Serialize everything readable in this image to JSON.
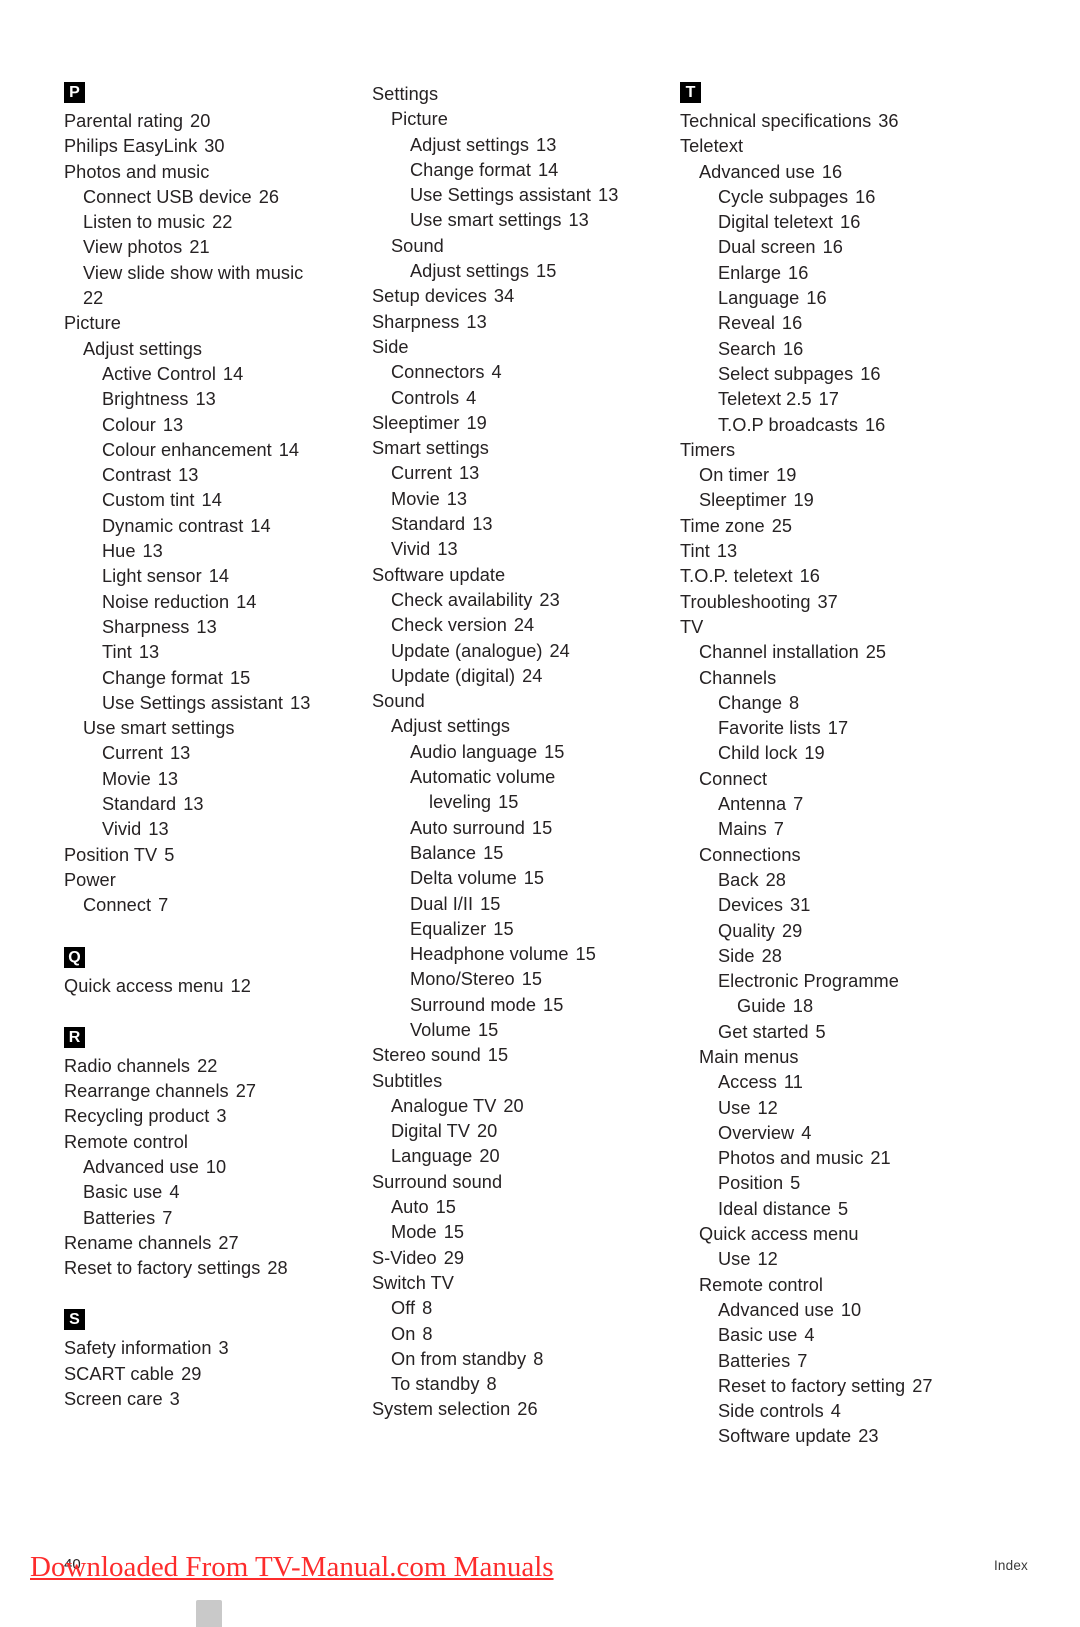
{
  "document": {
    "page_number": "40",
    "footer_label": "Index",
    "watermark_text": "Downloaded From TV-Manual.com Manuals"
  },
  "columns": [
    {
      "groups": [
        {
          "letter": "P",
          "entries": [
            {
              "text": "Parental rating",
              "page": "20",
              "level": 0
            },
            {
              "text": "Philips EasyLink",
              "page": "30",
              "level": 0
            },
            {
              "text": "Photos and music",
              "page": "",
              "level": 0
            },
            {
              "text": "Connect USB device",
              "page": "26",
              "level": 1
            },
            {
              "text": "Listen to music",
              "page": "22",
              "level": 1
            },
            {
              "text": "View photos",
              "page": "21",
              "level": 1
            },
            {
              "text": "View slide show with music",
              "page": "",
              "level": 1
            },
            {
              "text": "22",
              "page": "",
              "level": 1
            },
            {
              "text": "Picture",
              "page": "",
              "level": 0
            },
            {
              "text": "Adjust settings",
              "page": "",
              "level": 1
            },
            {
              "text": "Active Control",
              "page": "14",
              "level": 2
            },
            {
              "text": "Brightness",
              "page": "13",
              "level": 2
            },
            {
              "text": "Colour",
              "page": "13",
              "level": 2
            },
            {
              "text": "Colour enhancement",
              "page": "14",
              "level": 2
            },
            {
              "text": "Contrast",
              "page": "13",
              "level": 2
            },
            {
              "text": "Custom tint",
              "page": "14",
              "level": 2
            },
            {
              "text": "Dynamic contrast",
              "page": "14",
              "level": 2
            },
            {
              "text": "Hue",
              "page": "13",
              "level": 2
            },
            {
              "text": "Light sensor",
              "page": "14",
              "level": 2
            },
            {
              "text": "Noise reduction",
              "page": "14",
              "level": 2
            },
            {
              "text": "Sharpness",
              "page": "13",
              "level": 2
            },
            {
              "text": "Tint",
              "page": "13",
              "level": 2
            },
            {
              "text": "Change format",
              "page": "15",
              "level": 2
            },
            {
              "text": "Use Settings assistant",
              "page": "13",
              "level": 2
            },
            {
              "text": "Use smart settings",
              "page": "",
              "level": 1
            },
            {
              "text": "Current",
              "page": "13",
              "level": 2
            },
            {
              "text": "Movie",
              "page": "13",
              "level": 2
            },
            {
              "text": "Standard",
              "page": "13",
              "level": 2
            },
            {
              "text": "Vivid",
              "page": "13",
              "level": 2
            },
            {
              "text": "Position TV",
              "page": "5",
              "level": 0
            },
            {
              "text": "Power",
              "page": "",
              "level": 0
            },
            {
              "text": "Connect",
              "page": "7",
              "level": 1
            }
          ]
        },
        {
          "letter": "Q",
          "entries": [
            {
              "text": "Quick access menu",
              "page": "12",
              "level": 0
            }
          ]
        },
        {
          "letter": "R",
          "entries": [
            {
              "text": "Radio channels",
              "page": "22",
              "level": 0
            },
            {
              "text": "Rearrange channels",
              "page": "27",
              "level": 0
            },
            {
              "text": "Recycling product",
              "page": "3",
              "level": 0
            },
            {
              "text": "Remote control",
              "page": "",
              "level": 0
            },
            {
              "text": "Advanced use",
              "page": "10",
              "level": 1
            },
            {
              "text": "Basic use",
              "page": "4",
              "level": 1
            },
            {
              "text": "Batteries",
              "page": "7",
              "level": 1
            },
            {
              "text": "Rename channels",
              "page": "27",
              "level": 0
            },
            {
              "text": "Reset to factory settings",
              "page": "28",
              "level": 0
            }
          ]
        },
        {
          "letter": "S",
          "entries": [
            {
              "text": "Safety information",
              "page": "3",
              "level": 0
            },
            {
              "text": "SCART cable",
              "page": "29",
              "level": 0
            },
            {
              "text": "Screen care",
              "page": "3",
              "level": 0
            }
          ]
        }
      ]
    },
    {
      "groups": [
        {
          "letter": "",
          "entries": [
            {
              "text": "Settings",
              "page": "",
              "level": 0
            },
            {
              "text": "Picture",
              "page": "",
              "level": 1
            },
            {
              "text": "Adjust settings",
              "page": "13",
              "level": 2
            },
            {
              "text": "Change format",
              "page": "14",
              "level": 2
            },
            {
              "text": "Use Settings assistant",
              "page": "13",
              "level": 2
            },
            {
              "text": "Use smart settings",
              "page": "13",
              "level": 2
            },
            {
              "text": "Sound",
              "page": "",
              "level": 1
            },
            {
              "text": "Adjust settings",
              "page": "15",
              "level": 2
            },
            {
              "text": "Setup devices",
              "page": "34",
              "level": 0
            },
            {
              "text": "Sharpness",
              "page": "13",
              "level": 0
            },
            {
              "text": "Side",
              "page": "",
              "level": 0
            },
            {
              "text": "Connectors",
              "page": "4",
              "level": 1
            },
            {
              "text": "Controls",
              "page": "4",
              "level": 1
            },
            {
              "text": "Sleeptimer",
              "page": "19",
              "level": 0
            },
            {
              "text": "Smart settings",
              "page": "",
              "level": 0
            },
            {
              "text": "Current",
              "page": "13",
              "level": 1
            },
            {
              "text": "Movie",
              "page": "13",
              "level": 1
            },
            {
              "text": "Standard",
              "page": "13",
              "level": 1
            },
            {
              "text": "Vivid",
              "page": "13",
              "level": 1
            },
            {
              "text": "Software update",
              "page": "",
              "level": 0
            },
            {
              "text": "Check availability",
              "page": "23",
              "level": 1
            },
            {
              "text": "Check version",
              "page": "24",
              "level": 1
            },
            {
              "text": "Update (analogue)",
              "page": "24",
              "level": 1
            },
            {
              "text": "Update (digital)",
              "page": "24",
              "level": 1
            },
            {
              "text": "Sound",
              "page": "",
              "level": 0
            },
            {
              "text": "Adjust settings",
              "page": "",
              "level": 1
            },
            {
              "text": "Audio language",
              "page": "15",
              "level": 2
            },
            {
              "text": "Automatic volume",
              "page": "",
              "level": 2
            },
            {
              "text": "leveling",
              "page": "15",
              "level": 3
            },
            {
              "text": "Auto surround",
              "page": "15",
              "level": 2
            },
            {
              "text": "Balance",
              "page": "15",
              "level": 2
            },
            {
              "text": "Delta volume",
              "page": "15",
              "level": 2
            },
            {
              "text": "Dual I/II",
              "page": "15",
              "level": 2
            },
            {
              "text": "Equalizer",
              "page": "15",
              "level": 2
            },
            {
              "text": "Headphone volume",
              "page": "15",
              "level": 2
            },
            {
              "text": "Mono/Stereo",
              "page": "15",
              "level": 2
            },
            {
              "text": "Surround mode",
              "page": "15",
              "level": 2
            },
            {
              "text": "Volume",
              "page": "15",
              "level": 2
            },
            {
              "text": "Stereo sound",
              "page": "15",
              "level": 0
            },
            {
              "text": "Subtitles",
              "page": "",
              "level": 0
            },
            {
              "text": "Analogue TV",
              "page": "20",
              "level": 1
            },
            {
              "text": "Digital TV",
              "page": "20",
              "level": 1
            },
            {
              "text": "Language",
              "page": "20",
              "level": 1
            },
            {
              "text": "Surround sound",
              "page": "",
              "level": 0
            },
            {
              "text": "Auto",
              "page": "15",
              "level": 1
            },
            {
              "text": "Mode",
              "page": "15",
              "level": 1
            },
            {
              "text": "S-Video",
              "page": "29",
              "level": 0
            },
            {
              "text": "Switch TV",
              "page": "",
              "level": 0
            },
            {
              "text": "Off",
              "page": "8",
              "level": 1
            },
            {
              "text": "On",
              "page": "8",
              "level": 1
            },
            {
              "text": "On from standby",
              "page": "8",
              "level": 1
            },
            {
              "text": "To standby",
              "page": "8",
              "level": 1
            },
            {
              "text": "System selection",
              "page": "26",
              "level": 0
            }
          ]
        }
      ]
    },
    {
      "groups": [
        {
          "letter": "T",
          "entries": [
            {
              "text": "Technical specifications",
              "page": "36",
              "level": 0
            },
            {
              "text": "Teletext",
              "page": "",
              "level": 0
            },
            {
              "text": "Advanced use",
              "page": "16",
              "level": 1
            },
            {
              "text": "Cycle subpages",
              "page": "16",
              "level": 2
            },
            {
              "text": "Digital teletext",
              "page": "16",
              "level": 2
            },
            {
              "text": "Dual screen",
              "page": "16",
              "level": 2
            },
            {
              "text": "Enlarge",
              "page": "16",
              "level": 2
            },
            {
              "text": "Language",
              "page": "16",
              "level": 2
            },
            {
              "text": "Reveal",
              "page": "16",
              "level": 2
            },
            {
              "text": "Search",
              "page": "16",
              "level": 2
            },
            {
              "text": "Select subpages",
              "page": "16",
              "level": 2
            },
            {
              "text": "Teletext 2.5",
              "page": "17",
              "level": 2
            },
            {
              "text": "T.O.P broadcasts",
              "page": "16",
              "level": 2
            },
            {
              "text": "Timers",
              "page": "",
              "level": 0
            },
            {
              "text": "On timer",
              "page": "19",
              "level": 1
            },
            {
              "text": "Sleeptimer",
              "page": "19",
              "level": 1
            },
            {
              "text": "Time zone",
              "page": "25",
              "level": 0
            },
            {
              "text": "Tint",
              "page": "13",
              "level": 0
            },
            {
              "text": "T.O.P. teletext",
              "page": "16",
              "level": 0
            },
            {
              "text": "Troubleshooting",
              "page": "37",
              "level": 0
            },
            {
              "text": "TV",
              "page": "",
              "level": 0
            },
            {
              "text": "Channel installation",
              "page": "25",
              "level": 1
            },
            {
              "text": "Channels",
              "page": "",
              "level": 1
            },
            {
              "text": "Change",
              "page": "8",
              "level": 2
            },
            {
              "text": "Favorite lists",
              "page": "17",
              "level": 2
            },
            {
              "text": "Child lock",
              "page": "19",
              "level": 2
            },
            {
              "text": "Connect",
              "page": "",
              "level": 1
            },
            {
              "text": "Antenna",
              "page": "7",
              "level": 2
            },
            {
              "text": "Mains",
              "page": "7",
              "level": 2
            },
            {
              "text": "Connections",
              "page": "",
              "level": 1
            },
            {
              "text": "Back",
              "page": "28",
              "level": 2
            },
            {
              "text": "Devices",
              "page": "31",
              "level": 2
            },
            {
              "text": "Quality",
              "page": "29",
              "level": 2
            },
            {
              "text": "Side",
              "page": "28",
              "level": 2
            },
            {
              "text": "Electronic Programme",
              "page": "",
              "level": 2
            },
            {
              "text": "Guide",
              "page": "18",
              "level": 3
            },
            {
              "text": "Get started",
              "page": "5",
              "level": 2
            },
            {
              "text": "Main menus",
              "page": "",
              "level": 1
            },
            {
              "text": "Access",
              "page": "11",
              "level": 2
            },
            {
              "text": "Use",
              "page": "12",
              "level": 2
            },
            {
              "text": "Overview",
              "page": "4",
              "level": 2
            },
            {
              "text": "Photos and music",
              "page": "21",
              "level": 2
            },
            {
              "text": "Position",
              "page": "5",
              "level": 2
            },
            {
              "text": "Ideal distance",
              "page": "5",
              "level": 2
            },
            {
              "text": "Quick access menu",
              "page": "",
              "level": 1
            },
            {
              "text": "Use",
              "page": "12",
              "level": 2
            },
            {
              "text": "Remote control",
              "page": "",
              "level": 1
            },
            {
              "text": "Advanced use",
              "page": "10",
              "level": 2
            },
            {
              "text": "Basic use",
              "page": "4",
              "level": 2
            },
            {
              "text": "Batteries",
              "page": "7",
              "level": 2
            },
            {
              "text": "Reset to factory setting",
              "page": "27",
              "level": 2
            },
            {
              "text": "Side controls",
              "page": "4",
              "level": 2
            },
            {
              "text": "Software update",
              "page": "23",
              "level": 2
            }
          ]
        }
      ]
    }
  ]
}
